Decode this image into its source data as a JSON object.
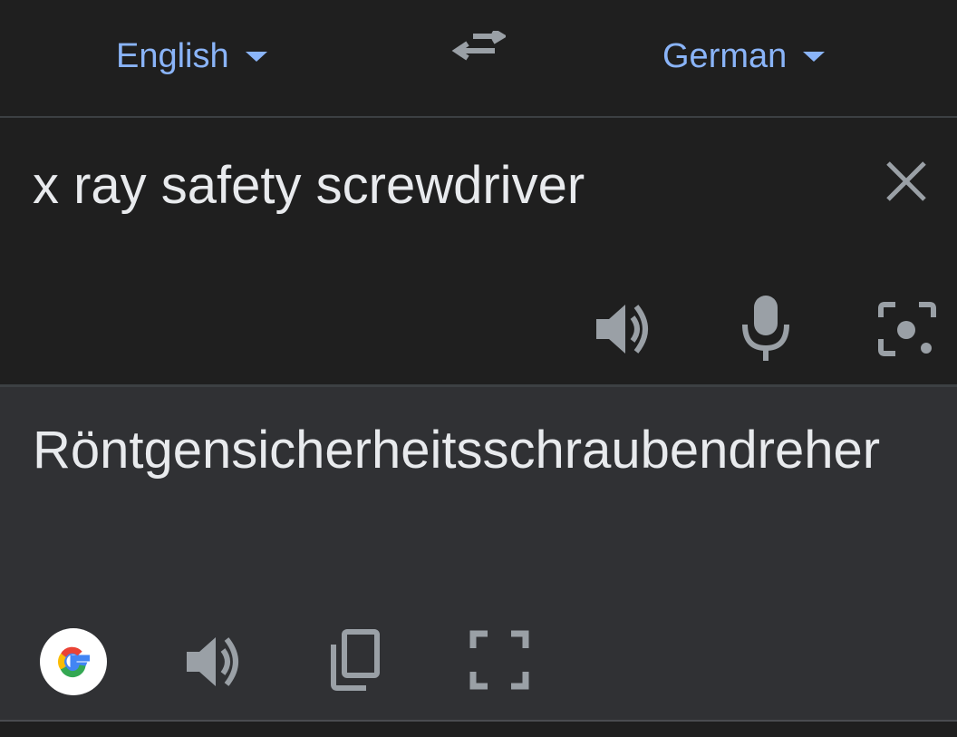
{
  "source_language": {
    "label": "English",
    "icon": "caret-down-icon"
  },
  "target_language": {
    "label": "German",
    "icon": "caret-down-icon"
  },
  "swap_icon": "swap-arrows-icon",
  "input": {
    "text": "x ray safety screwdriver"
  },
  "output": {
    "text": "Röntgensicherheitsschraubendreher"
  },
  "colors": {
    "accent": "#8ab4f8",
    "text": "#e8eaed",
    "icon": "#9aa0a6",
    "input_bg": "#1f1f1f",
    "output_bg": "#303134"
  }
}
